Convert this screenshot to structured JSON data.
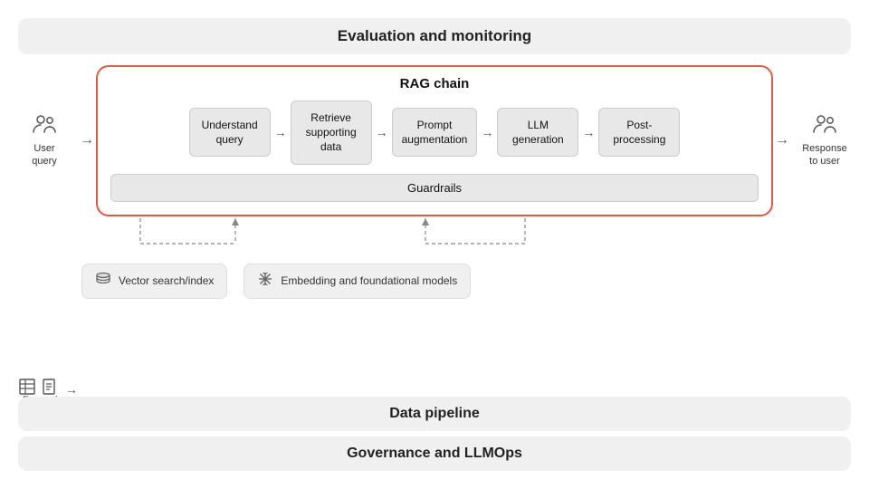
{
  "diagram": {
    "eval_banner": "Evaluation and monitoring",
    "data_pipeline_banner": "Data pipeline",
    "governance_banner": "Governance and LLMOps",
    "rag_chain_title": "RAG chain",
    "user_query_label": "User\nquery",
    "response_label": "Response\nto user",
    "steps": [
      {
        "id": "understand",
        "text": "Understand\nquery"
      },
      {
        "id": "retrieve",
        "text": "Retrieve\nsupporting\ndata"
      },
      {
        "id": "prompt",
        "text": "Prompt\naugmentation"
      },
      {
        "id": "llm",
        "text": "LLM\ngeneration"
      },
      {
        "id": "postprocess",
        "text": "Post-\nprocessing"
      }
    ],
    "guardrails_label": "Guardrails",
    "chips": [
      {
        "id": "vector-search",
        "icon": "layers",
        "text": "Vector search/index"
      },
      {
        "id": "embedding",
        "icon": "snowflake",
        "text": "Embedding and foundational models"
      }
    ],
    "enterprise_label": "Enterprise\ndata",
    "arrow_symbol": "→",
    "colors": {
      "rag_border": "#e05a4a",
      "box_bg": "#e8e8e8",
      "banner_bg": "#f0f0f0"
    }
  }
}
